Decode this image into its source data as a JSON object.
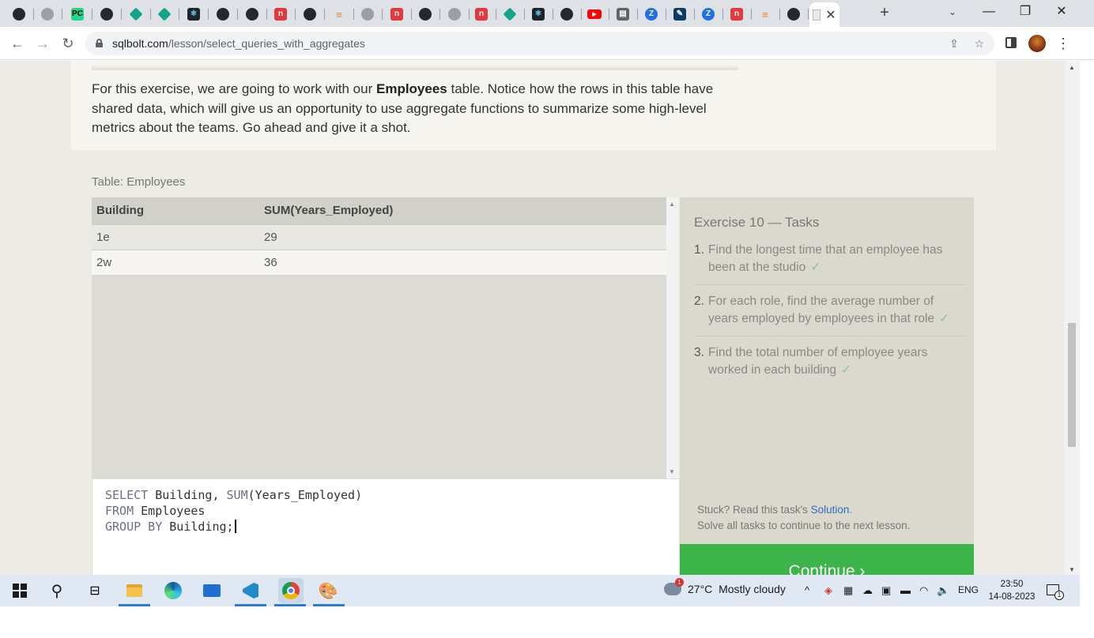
{
  "browser": {
    "tabs": [
      {
        "icon": "github-icon",
        "kind": "github",
        "glyph": ""
      },
      {
        "icon": "gear-icon",
        "kind": "gear",
        "glyph": ""
      },
      {
        "icon": "pycharm-icon",
        "kind": "jb",
        "glyph": "PC"
      },
      {
        "icon": "github-icon",
        "kind": "github",
        "glyph": ""
      },
      {
        "icon": "diamond-icon",
        "kind": "diamond",
        "glyph": ""
      },
      {
        "icon": "diamond-icon",
        "kind": "diamond",
        "glyph": ""
      },
      {
        "icon": "react-icon",
        "kind": "react",
        "glyph": "⚛"
      },
      {
        "icon": "github-icon",
        "kind": "github",
        "glyph": ""
      },
      {
        "icon": "github-icon",
        "kind": "github",
        "glyph": ""
      },
      {
        "icon": "red-n-icon",
        "kind": "red",
        "glyph": "n"
      },
      {
        "icon": "github-icon",
        "kind": "github",
        "glyph": ""
      },
      {
        "icon": "stackoverflow-icon",
        "kind": "so",
        "glyph": "≡"
      },
      {
        "icon": "gear-icon",
        "kind": "gear",
        "glyph": ""
      },
      {
        "icon": "red-n-icon",
        "kind": "red",
        "glyph": "n"
      },
      {
        "icon": "github-icon",
        "kind": "github",
        "glyph": ""
      },
      {
        "icon": "gear-icon",
        "kind": "gear",
        "glyph": ""
      },
      {
        "icon": "red-n-icon",
        "kind": "red",
        "glyph": "n"
      },
      {
        "icon": "diamond-icon",
        "kind": "diamond",
        "glyph": ""
      },
      {
        "icon": "react-icon",
        "kind": "react",
        "glyph": "⚛"
      },
      {
        "icon": "github-icon",
        "kind": "github",
        "glyph": ""
      },
      {
        "icon": "youtube-icon",
        "kind": "yt",
        "glyph": "▶"
      },
      {
        "icon": "document-icon",
        "kind": "doc",
        "glyph": "▤"
      },
      {
        "icon": "z-icon",
        "kind": "z",
        "glyph": "Z"
      },
      {
        "icon": "feather-icon",
        "kind": "blue",
        "glyph": "✎"
      },
      {
        "icon": "z-icon",
        "kind": "z",
        "glyph": "Z"
      },
      {
        "icon": "red-n-icon",
        "kind": "red",
        "glyph": "n"
      },
      {
        "icon": "stackoverflow-icon",
        "kind": "so",
        "glyph": "≡"
      },
      {
        "icon": "github-icon",
        "kind": "github",
        "glyph": ""
      }
    ],
    "active_tab_icon": "sqlbolt-icon",
    "url_host": "sqlbolt.com",
    "url_path": "/lesson/select_queries_with_aggregates"
  },
  "intro": {
    "before_bold": "For this exercise, we are going to work with our ",
    "bold": "Employees",
    "after_bold": " table. Notice how the rows in this table have shared data, which will give us an opportunity to use aggregate functions to summarize some high-level metrics about the teams. Go ahead and give it a shot."
  },
  "table": {
    "caption": "Table: Employees",
    "columns": [
      "Building",
      "SUM(Years_Employed)"
    ],
    "rows": [
      [
        "1e",
        "29"
      ],
      [
        "2w",
        "36"
      ]
    ]
  },
  "editor": {
    "lines": [
      [
        {
          "kw": "SELECT"
        },
        {
          "t": " Building, "
        },
        {
          "kw": "SUM"
        },
        {
          "t": "(Years_Employed)"
        }
      ],
      [
        {
          "kw": "FROM"
        },
        {
          "t": " Employees"
        }
      ],
      [
        {
          "kw": "GROUP BY"
        },
        {
          "t": " Building;"
        }
      ]
    ]
  },
  "tasks": {
    "title": "Exercise 10 — Tasks",
    "items": [
      {
        "num": "1.",
        "text": "Find the longest time that an employee has been at the studio",
        "check": "✓"
      },
      {
        "num": "2.",
        "text": "For each role, find the average number of years employed by employees in that role",
        "check": "✓"
      },
      {
        "num": "3.",
        "text": "Find the total number of employee years worked in each building",
        "check": "✓"
      }
    ],
    "stuck_prefix": "Stuck? Read this task's ",
    "solution_link": "Solution",
    "stuck_suffix": ".",
    "solve_all": "Solve all tasks to continue to the next lesson.",
    "continue_label": "Continue ›"
  },
  "taskbar": {
    "weather_temp": "27°C",
    "weather_desc": "Mostly cloudy",
    "weather_badge": "1",
    "lang": "ENG",
    "time": "23:50",
    "date": "14-08-2023",
    "notification_count": "1"
  }
}
